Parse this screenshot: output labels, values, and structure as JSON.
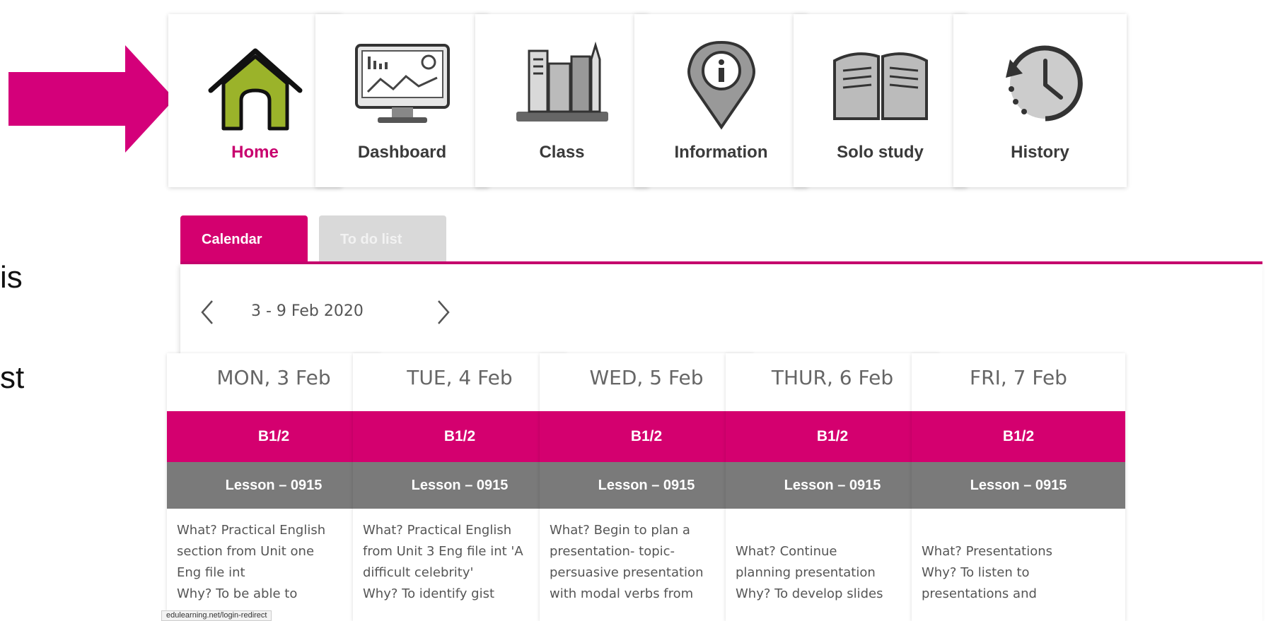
{
  "slide_fragments": [
    "is",
    "st"
  ],
  "nav_tiles": [
    {
      "label": "Home",
      "icon": "home-icon",
      "active": true
    },
    {
      "label": "Dashboard",
      "icon": "dashboard-monitor-icon",
      "active": false
    },
    {
      "label": "Class",
      "icon": "books-icon",
      "active": false
    },
    {
      "label": "Information",
      "icon": "info-pin-icon",
      "active": false
    },
    {
      "label": "Solo study",
      "icon": "open-book-icon",
      "active": false
    },
    {
      "label": "History",
      "icon": "history-clock-icon",
      "active": false
    }
  ],
  "tabs": [
    {
      "label": "Calendar",
      "active": true
    },
    {
      "label": "To do list",
      "active": false
    }
  ],
  "week": {
    "range": "3 - 9 Feb 2020"
  },
  "days": [
    {
      "heading": "MON, 3 Feb",
      "class": "B1/2",
      "lesson": "Lesson – 0915",
      "description": "What? Practical English\nsection from Unit one\nEng file int\nWhy? To be able to"
    },
    {
      "heading": "TUE, 4 Feb",
      "class": "B1/2",
      "lesson": "Lesson – 0915",
      "description": "What? Practical English\nfrom Unit 3 Eng file int 'A\ndifficult celebrity'\nWhy? To identify gist"
    },
    {
      "heading": "WED, 5 Feb",
      "class": "B1/2",
      "lesson": "Lesson – 0915",
      "description": "What? Begin to plan a\npresentation- topic-\npersuasive presentation\nwith modal verbs from"
    },
    {
      "heading": "THUR, 6 Feb",
      "class": "B1/2",
      "lesson": "Lesson – 0915",
      "description": "\nWhat? Continue\nplanning presentation\nWhy? To develop slides"
    },
    {
      "heading": "FRI, 7 Feb",
      "class": "B1/2",
      "lesson": "Lesson – 0915",
      "description": "\nWhat? Presentations\nWhy? To listen to\npresentations and"
    }
  ],
  "status_url": "edulearning.net/login-redirect",
  "colors": {
    "accent": "#d4006f",
    "arrow": "#d4007a",
    "home_green": "#9bb32a",
    "lesson_gray": "#7a7a7a"
  }
}
